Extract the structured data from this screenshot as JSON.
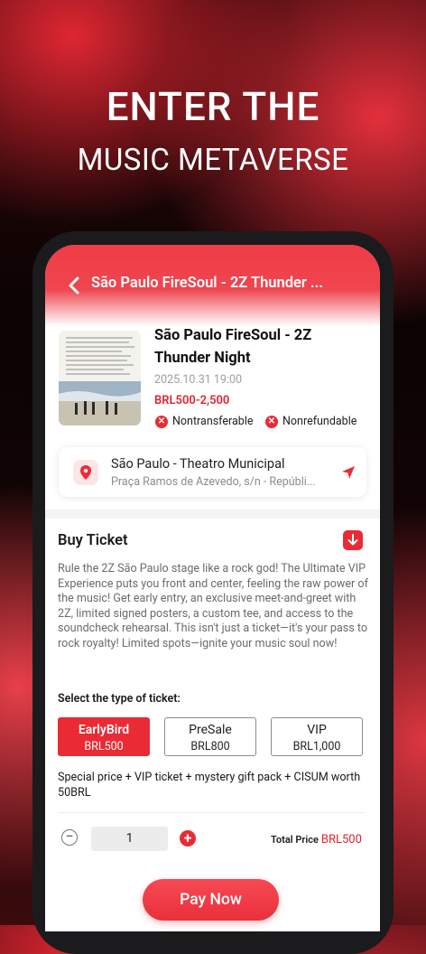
{
  "hero": {
    "line1": "ENTER THE",
    "line2": "MUSIC METAVERSE"
  },
  "header": {
    "title": "São Paulo FireSoul - 2Z Thunder ..."
  },
  "event": {
    "title": "São Paulo FireSoul - 2Z Thunder Night",
    "datetime": "2025.10.31 19:00",
    "price_range": "BRL500-2,500",
    "tags": [
      "Nontransferable",
      "Nonrefundable"
    ]
  },
  "location": {
    "name": "São Paulo - Theatro Municipal",
    "address": "Praça Ramos de Azevedo, s/n - Repúbli..."
  },
  "buy": {
    "title": "Buy Ticket",
    "description": "Rule the 2Z São Paulo stage like a rock god! The Ultimate VIP Experience puts you front and center, feeling the raw power of the music! Get early entry, an exclusive meet-and-greet with 2Z, limited signed posters, a custom tee, and access to the soundcheck rehearsal. This isn't just a ticket—it's your pass to rock royalty! Limited spots—ignite your music soul now!",
    "select_label": "Select the type of ticket:",
    "options": [
      {
        "name": "EarlyBird",
        "price": "BRL500"
      },
      {
        "name": "PreSale",
        "price": "BRL800"
      },
      {
        "name": "VIP",
        "price": "BRL1,000"
      }
    ],
    "selected_option": "EarlyBird",
    "special": "Special price + VIP ticket + mystery gift pack + CISUM worth 50BRL",
    "quantity": "1",
    "total_label": "Total Price",
    "total_value": "BRL500",
    "pay_label": "Pay Now"
  },
  "colors": {
    "accent": "#ea2b35",
    "header": "#f03b45"
  }
}
